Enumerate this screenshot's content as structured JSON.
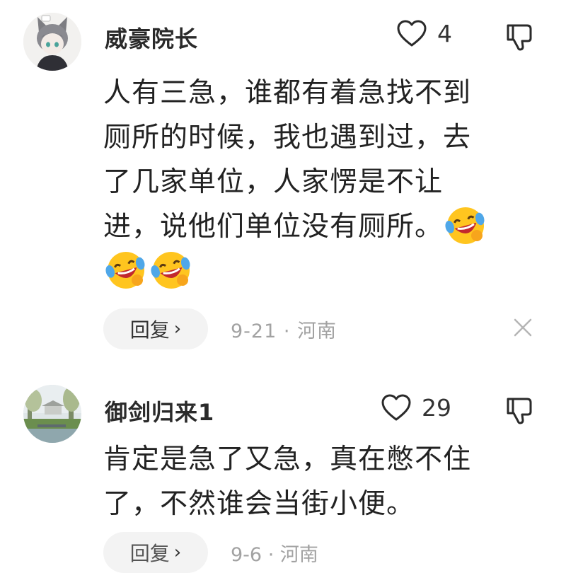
{
  "comments": [
    {
      "username": "威豪院长",
      "likes": "4",
      "lines": [
        "人有三急，谁都有着急找不到",
        "厕所的时候，我也遇到过，去",
        "了几家单位，人家愣是不让",
        "进，说他们单位没有厕所。"
      ],
      "reply_label": "回复",
      "reply_chevron": "›",
      "date": "9-21",
      "separator": "·",
      "location": "河南",
      "emoji": "laugh-cry-emoji"
    },
    {
      "username": "御剑归来1",
      "likes": "29",
      "lines": [
        "肯定是急了又急，真在憋不住",
        "了，不然谁会当街小便。"
      ],
      "reply_label": "回复",
      "reply_chevron": "›",
      "date": "9-6",
      "separator": "·",
      "location": "河南"
    }
  ],
  "colors": {
    "emoji_face": "#FFC51F",
    "emoji_mouth": "#C2282E",
    "emoji_tear": "#4FA7E8",
    "meta_text": "#A2A2A2",
    "reply_bg": "#F3F3F3"
  }
}
